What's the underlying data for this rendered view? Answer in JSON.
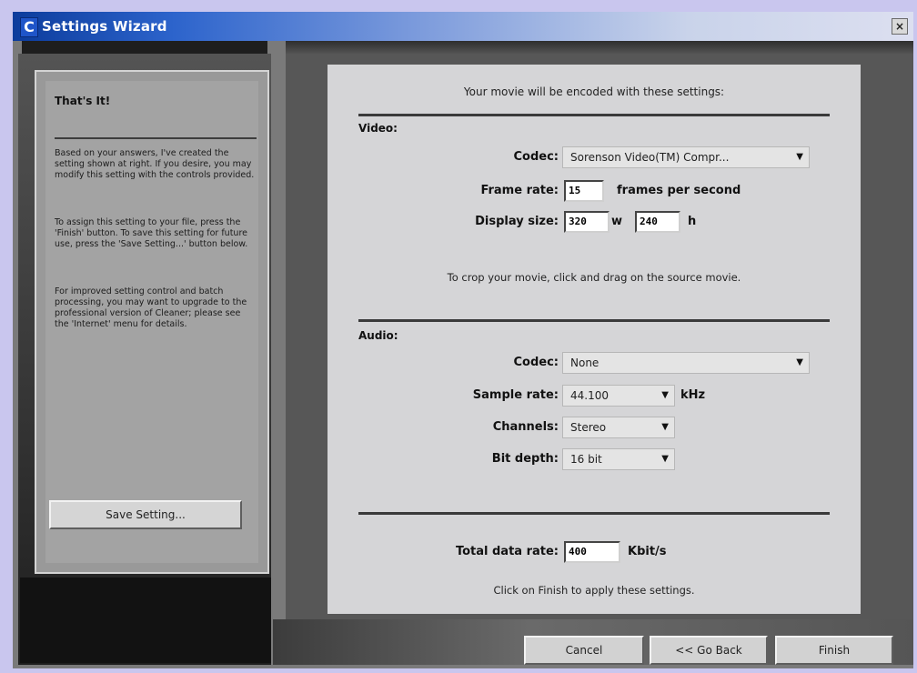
{
  "window": {
    "title": "Settings Wizard",
    "close_label": "×",
    "icon_label": "C"
  },
  "left": {
    "heading": "That's It!",
    "paragraphs": [
      "Based on your answers, I've created the setting shown at right.  If you desire, you may modify this setting with the controls provided.",
      "To assign this setting to your file, press the 'Finish' button. To save this setting for future use, press the 'Save Setting...' button below.",
      "For improved setting control and batch processing, you may want to upgrade to the professional version of Cleaner; please see the 'Internet' menu for details."
    ],
    "save_button": "Save Setting..."
  },
  "main": {
    "header": "Your movie will be encoded with these settings:",
    "video": {
      "section": "Video:",
      "codec_label": "Codec:",
      "codec_value": "Sorenson Video(TM) Compr...",
      "framerate_label": "Frame rate:",
      "framerate_value": "15",
      "framerate_unit": "frames per second",
      "display_label": "Display size:",
      "width_value": "320",
      "width_unit": "w",
      "height_value": "240",
      "height_unit": "h",
      "crop_note": "To crop your movie, click and drag on the source movie."
    },
    "audio": {
      "section": "Audio:",
      "codec_label": "Codec:",
      "codec_value": "None",
      "samplerate_label": "Sample rate:",
      "samplerate_value": "44.100",
      "samplerate_unit": "kHz",
      "channels_label": "Channels:",
      "channels_value": "Stereo",
      "bitdepth_label": "Bit depth:",
      "bitdepth_value": "16 bit"
    },
    "total_label": "Total data rate:",
    "total_value": "400",
    "total_unit": "Kbit/s",
    "finish_note": "Click on Finish to apply these settings."
  },
  "buttons": {
    "cancel": "Cancel",
    "back": "<< Go Back",
    "finish": "Finish"
  }
}
